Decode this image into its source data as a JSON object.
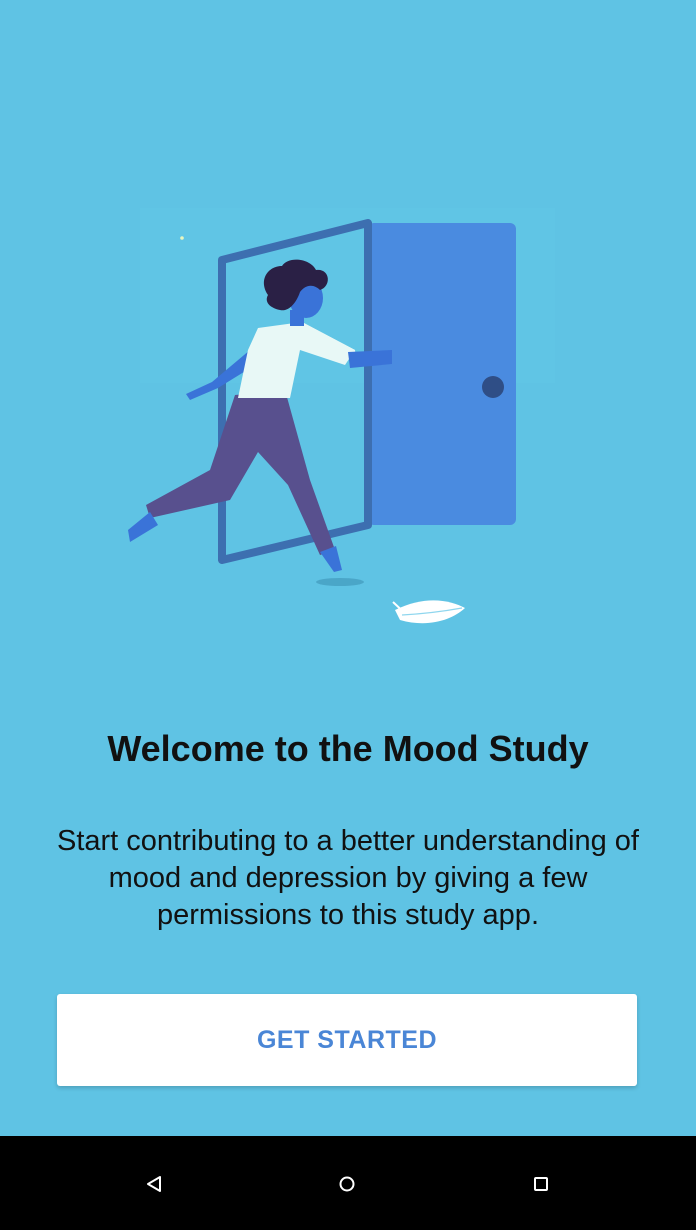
{
  "welcome": {
    "title": "Welcome to the Mood Study",
    "description": "Start contributing to a better understanding of mood and depression by giving a few permissions to this study app.",
    "cta_label": "GET STARTED"
  },
  "illustration": {
    "name": "person-walking-through-door-illustration"
  },
  "nav_bar": {
    "buttons": [
      "back-icon",
      "home-icon",
      "recents-icon"
    ]
  },
  "colors": {
    "background": "#5fc3e4",
    "button_text": "#4a86d6",
    "door": "#4a8be0",
    "frame": "#3d6fb0"
  }
}
